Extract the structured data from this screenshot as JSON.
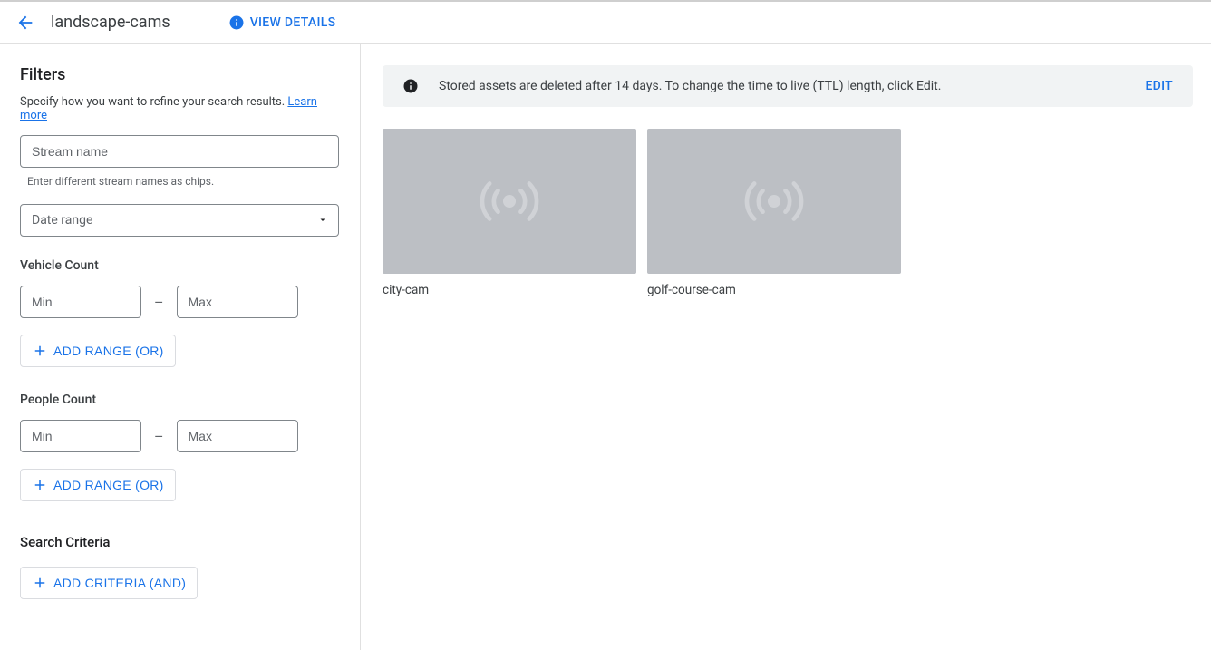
{
  "header": {
    "title": "landscape-cams",
    "view_details": "VIEW DETAILS"
  },
  "filters": {
    "title": "Filters",
    "subtitle": "Specify how you want to refine your search results.",
    "learn_more": "Learn more",
    "stream_name_placeholder": "Stream name",
    "stream_name_help": "Enter different stream names as chips.",
    "date_range_label": "Date range",
    "vehicle_count_label": "Vehicle Count",
    "people_count_label": "People Count",
    "min_placeholder": "Min",
    "max_placeholder": "Max",
    "range_separator": "–",
    "add_range_label": "ADD RANGE (OR)",
    "search_criteria_title": "Search Criteria",
    "add_criteria_label": "ADD CRITERIA (AND)"
  },
  "content": {
    "banner_text": "Stored assets are deleted after 14 days. To change the time to live (TTL) length, click Edit.",
    "banner_edit_label": "EDIT",
    "cards": {
      "0": {
        "label": "city-cam"
      },
      "1": {
        "label": "golf-course-cam"
      }
    }
  }
}
